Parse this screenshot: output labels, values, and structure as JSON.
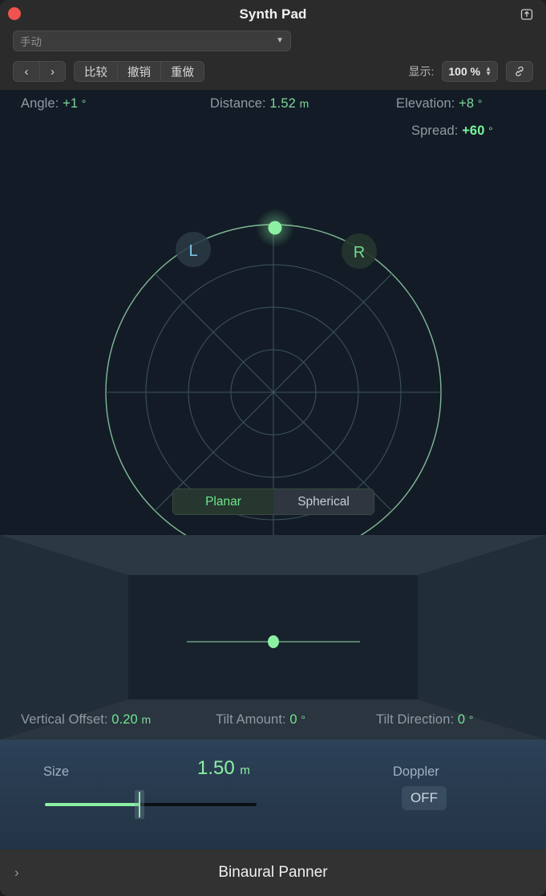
{
  "window": {
    "title": "Synth Pad",
    "close_icon": "close-traffic-light",
    "share_icon": "share-export-icon"
  },
  "toolbar": {
    "preset_value": "手动",
    "preset_chevron_icon": "chevron-down-icon",
    "prev_icon": "‹",
    "next_icon": "›",
    "compare_label": "比较",
    "undo_label": "撤销",
    "redo_label": "重做",
    "display_label": "显示:",
    "zoom_value": "100 %",
    "stepper_up": "▲",
    "stepper_down": "▼",
    "link_icon": "link-chain-icon"
  },
  "panner": {
    "angle_key": "Angle:",
    "angle_value": "+1",
    "angle_unit": "°",
    "distance_key": "Distance:",
    "distance_value": "1.52",
    "distance_unit": "m",
    "elevation_key": "Elevation:",
    "elevation_value": "+8",
    "elevation_unit": "°",
    "spread_key": "Spread:",
    "spread_value": "+60",
    "spread_unit": "°",
    "left_marker": "L",
    "right_marker": "R",
    "mode_planar": "Planar",
    "mode_spherical": "Spherical",
    "selected_mode": "Planar"
  },
  "room": {
    "vertical_offset_key": "Vertical Offset:",
    "vertical_offset_value": "0.20",
    "vertical_offset_unit": "m",
    "tilt_amount_key": "Tilt Amount:",
    "tilt_amount_value": "0",
    "tilt_amount_unit": "°",
    "tilt_direction_key": "Tilt Direction:",
    "tilt_direction_value": "0",
    "tilt_direction_unit": "°"
  },
  "size_section": {
    "size_label": "Size",
    "size_value": "1.50",
    "size_unit": "m",
    "doppler_label": "Doppler",
    "doppler_state": "OFF"
  },
  "footer": {
    "plugin_name": "Binaural Panner",
    "expand_icon": "chevron-right-icon"
  },
  "colors": {
    "accent_green": "#8cf0a2",
    "readout_green": "#7fd69a",
    "panner_bg": "#131c26",
    "left_marker_blue": "#7ec8f0",
    "close_red": "#f0534f"
  }
}
